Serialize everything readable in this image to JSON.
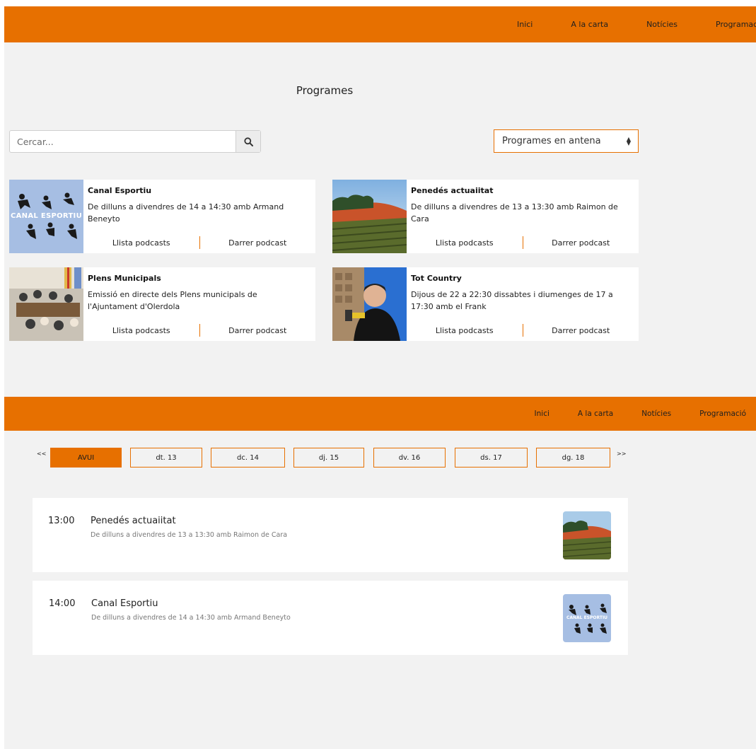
{
  "nav_top": {
    "items": [
      "Inici",
      "A la carta",
      "Notícies",
      "Programació"
    ]
  },
  "page_title": "Programes",
  "search": {
    "placeholder": "Cercar...",
    "icon": "search-icon"
  },
  "filter_select": {
    "value": "Programes en antena"
  },
  "programs": [
    {
      "title": "Canal Esportiu",
      "description": "De dilluns a divendres de 14 a 14:30 amb Armand Beneyto",
      "link_list": "Llista podcasts",
      "link_last": "Darrer podcast",
      "image_text": "CANAL ESPORTIU"
    },
    {
      "title": "Penedés actuaiitat",
      "description": "De dilluns a divendres de 13 a 13:30 amb Raimon de Cara",
      "link_list": "Llista podcasts",
      "link_last": "Darrer podcast"
    },
    {
      "title": "Plens Municipals",
      "description": "Emissió en directe dels Plens municipals de l'Ajuntament d'Olerdola",
      "link_list": "Llista podcasts",
      "link_last": "Darrer podcast"
    },
    {
      "title": "Tot Country",
      "description": "Dijous de 22 a 22:30 dissabtes i diumenges de 17 a 17:30 amb el Frank",
      "link_list": "Llista podcasts",
      "link_last": "Darrer podcast"
    }
  ],
  "nav_bottom": {
    "items": [
      "Inici",
      "A la carta",
      "Notícies",
      "Programació"
    ]
  },
  "schedule_pager": {
    "prev": "<<",
    "next": ">>"
  },
  "days": [
    "AVUI",
    "dt. 13",
    "dc. 14",
    "dj. 15",
    "dv. 16",
    "ds. 17",
    "dg. 18"
  ],
  "active_day": "AVUI",
  "schedule": [
    {
      "time": "13:00",
      "title": "Penedés actuaiitat",
      "description": "De dilluns a divendres de 13 a 13:30 amb Raimon de Cara"
    },
    {
      "time": "14:00",
      "title": "Canal Esportiu",
      "description": "De dilluns a divendres de 14 a 14:30 amb Armand Beneyto",
      "image_text": "CANAL ESPORTIU"
    }
  ],
  "colors": {
    "accent": "#e77000",
    "background": "#f2f2f2"
  }
}
